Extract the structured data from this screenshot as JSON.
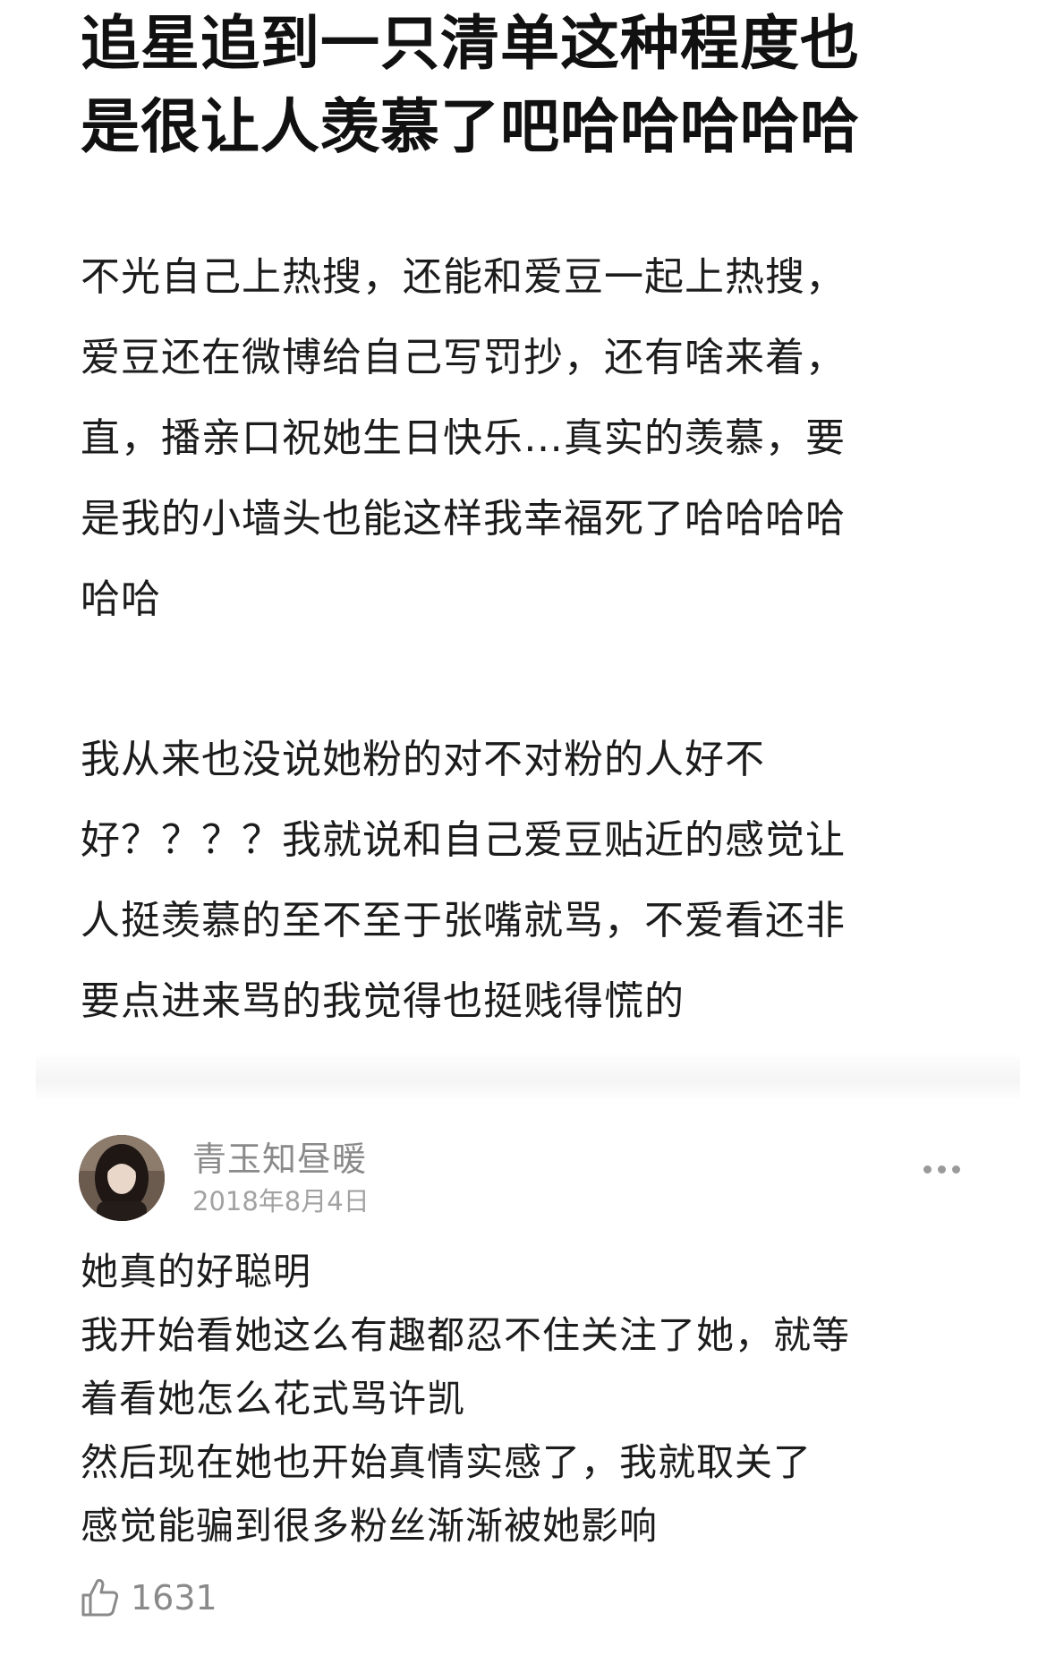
{
  "post": {
    "title": "追星追到一只清单这种程度也\n是很让人羡慕了吧哈哈哈哈哈",
    "paragraphs": [
      "不光自己上热搜，还能和爱豆一起上热搜，\n爱豆还在微博给自己写罚抄，还有啥来着，\n直，播亲口祝她生日快乐…真实的羡慕，要\n是我的小墙头也能这样我幸福死了哈哈哈哈\n哈哈",
      "我从来也没说她粉的对不对粉的人好不\n好？？？？我就说和自己爱豆贴近的感觉让\n人挺羡慕的至不至于张嘴就骂，不爱看还非\n要点进来骂的我觉得也挺贱得慌的"
    ]
  },
  "comment": {
    "author": "青玉知昼暖",
    "date": "2018年8月4日",
    "text": "她真的好聪明\n我开始看她这么有趣都忍不住关注了她，就等\n着看她怎么花式骂许凯\n然后现在她也开始真情实感了，我就取关了\n感觉能骗到很多粉丝渐渐被她影响",
    "likes": "1631",
    "icons": {
      "more": "more-dots-icon",
      "like": "thumbs-up-icon"
    }
  },
  "colors": {
    "title": "#111111",
    "body": "#1c1c1c",
    "meta": "#8a8a8a"
  }
}
